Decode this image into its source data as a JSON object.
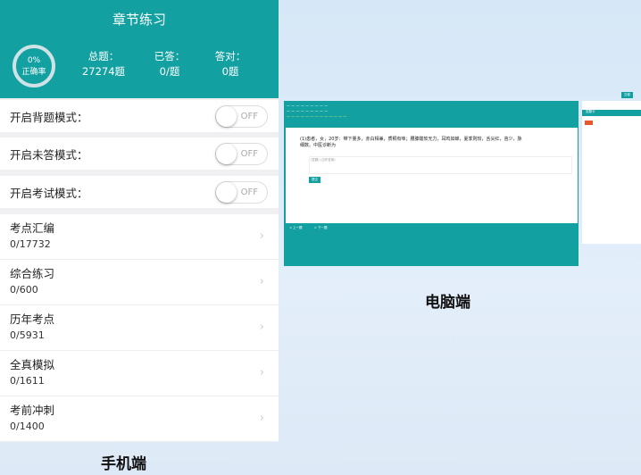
{
  "mobile": {
    "title": "章节练习",
    "accuracy": {
      "percent": "0%",
      "label": "正确率"
    },
    "stats": [
      {
        "label": "总题：",
        "value": "27274题"
      },
      {
        "label": "已答：",
        "value": "0/题"
      },
      {
        "label": "答对：",
        "value": "0题"
      }
    ],
    "toggles": [
      {
        "label": "开启背题模式：",
        "state": "OFF"
      },
      {
        "label": "开启未答模式：",
        "state": "OFF"
      },
      {
        "label": "开启考试模式：",
        "state": "OFF"
      }
    ],
    "items": [
      {
        "name": "考点汇编",
        "count": "0/17732"
      },
      {
        "name": "综合练习",
        "count": "0/600"
      },
      {
        "name": "历年考点",
        "count": "0/5931"
      },
      {
        "name": "全真模拟",
        "count": "0/1611"
      },
      {
        "name": "考前冲刺",
        "count": "0/1400"
      }
    ],
    "caption": "手机端"
  },
  "desktop": {
    "question": "(1)患者，女，20岁：带下量多，赤白相兼，质稠有味；腰膝酸软无力，耳鸣如蝉，夏季则较，舌尖红，苔少，脉细数。中医诊断为",
    "answer_placeholder": "(答题) (当作答案)",
    "submit": "提交",
    "prev": "< 上一题",
    "next": "> 下一题",
    "answer_card": "答题卡",
    "submit_top": "交卷",
    "caption": "电脑端"
  }
}
